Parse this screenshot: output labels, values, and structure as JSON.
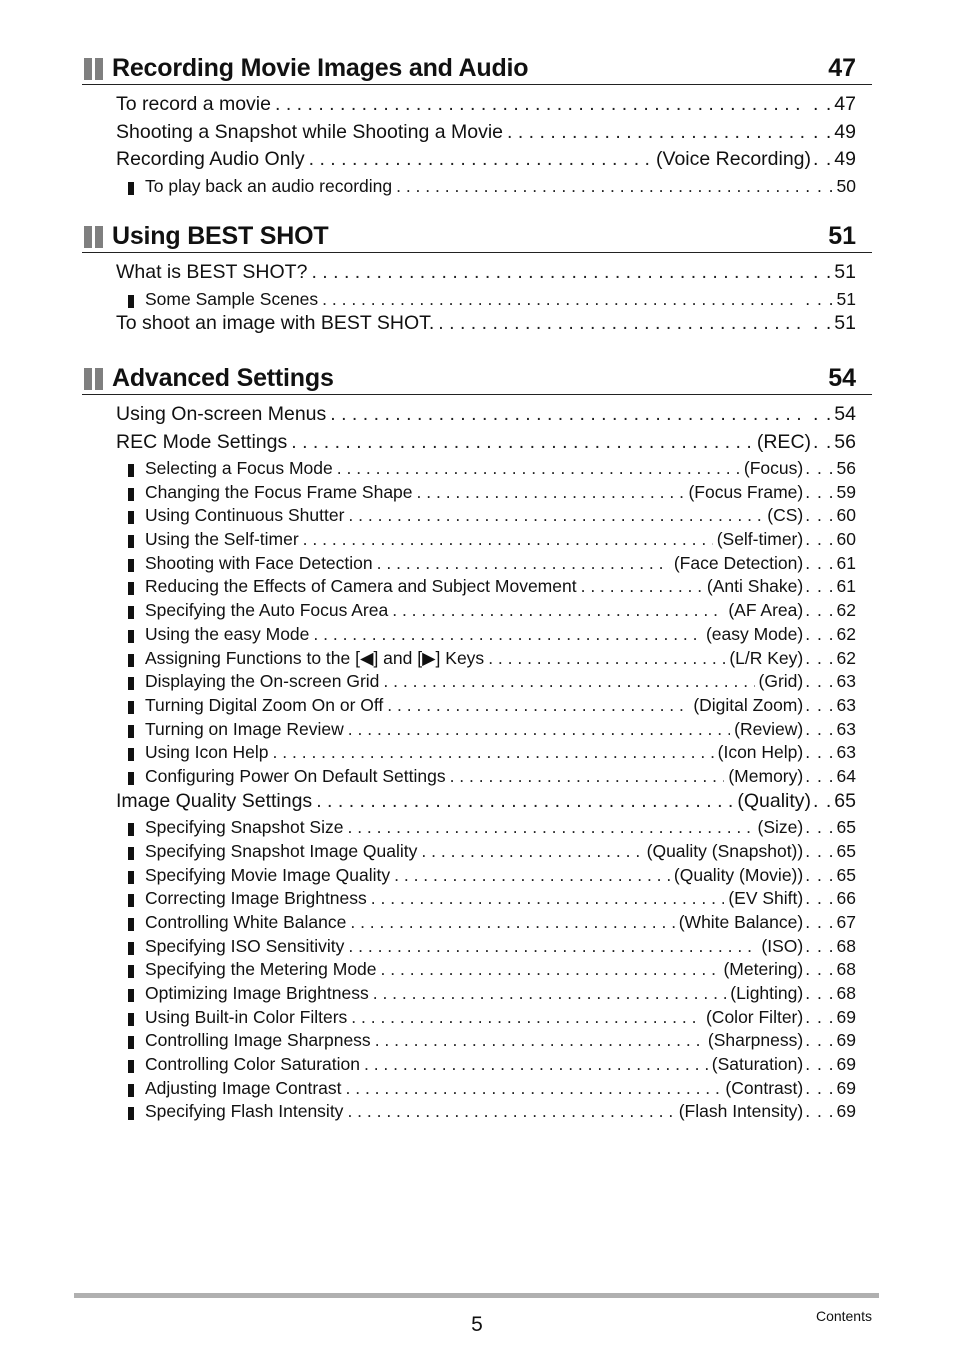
{
  "sections": [
    {
      "title": "Recording Movie Images and Audio",
      "page": "47",
      "entries": [
        {
          "level": "main",
          "label": "To record a movie",
          "tag": "",
          "page": "47"
        },
        {
          "level": "main",
          "label": "Shooting a Snapshot while Shooting a Movie",
          "tag": "",
          "page": "49"
        },
        {
          "level": "main",
          "label": "Recording Audio Only",
          "tag": "(Voice Recording)",
          "page": "49"
        },
        {
          "level": "sub",
          "label": "To play back an audio recording",
          "tag": "",
          "page": "50"
        }
      ]
    },
    {
      "title": "Using BEST SHOT",
      "page": "51",
      "entries": [
        {
          "level": "main",
          "label": "What is BEST SHOT?",
          "tag": "",
          "page": "51"
        },
        {
          "level": "sub",
          "label": "Some Sample Scenes",
          "tag": "",
          "page": "51"
        },
        {
          "level": "main",
          "label": "To shoot an image with BEST SHOT.",
          "tag": "",
          "page": "51"
        }
      ]
    },
    {
      "title": "Advanced Settings",
      "page": "54",
      "entries": [
        {
          "level": "main",
          "label": "Using On-screen Menus",
          "tag": "",
          "page": "54"
        },
        {
          "level": "main",
          "label": "REC Mode Settings",
          "tag": "(REC)",
          "page": "56"
        },
        {
          "level": "sub",
          "label": "Selecting a Focus Mode",
          "tag": "(Focus)",
          "page": "56"
        },
        {
          "level": "sub",
          "label": "Changing the Focus Frame Shape",
          "tag": "(Focus Frame)",
          "page": "59"
        },
        {
          "level": "sub",
          "label": "Using Continuous Shutter",
          "tag": "(CS)",
          "page": "60"
        },
        {
          "level": "sub",
          "label": "Using the Self-timer",
          "tag": "(Self-timer)",
          "page": "60"
        },
        {
          "level": "sub",
          "label": "Shooting with Face Detection",
          "tag": "(Face Detection)",
          "page": "61"
        },
        {
          "level": "sub",
          "label": "Reducing the Effects of Camera and Subject Movement",
          "tag": "(Anti Shake)",
          "page": "61"
        },
        {
          "level": "sub",
          "label": "Specifying the Auto Focus Area",
          "tag": "(AF Area)",
          "page": "62"
        },
        {
          "level": "sub",
          "label": "Using the easy Mode",
          "tag": "(easy Mode)",
          "page": "62"
        },
        {
          "level": "sub",
          "label": "Assigning Functions to the [◀] and [▶] Keys",
          "tag": "(L/R Key)",
          "page": "62"
        },
        {
          "level": "sub",
          "label": "Displaying the On-screen Grid",
          "tag": "(Grid)",
          "page": "63"
        },
        {
          "level": "sub",
          "label": "Turning Digital Zoom On or Off",
          "tag": "(Digital Zoom)",
          "page": "63"
        },
        {
          "level": "sub",
          "label": "Turning on Image Review",
          "tag": "(Review)",
          "page": "63"
        },
        {
          "level": "sub",
          "label": "Using Icon Help",
          "tag": "(Icon Help)",
          "page": "63"
        },
        {
          "level": "sub",
          "label": "Configuring Power On Default Settings",
          "tag": "(Memory)",
          "page": "64"
        },
        {
          "level": "main",
          "label": "Image Quality Settings",
          "tag": "(Quality)",
          "page": "65"
        },
        {
          "level": "sub",
          "label": "Specifying Snapshot Size",
          "tag": "(Size)",
          "page": "65"
        },
        {
          "level": "sub",
          "label": "Specifying Snapshot Image Quality",
          "tag": "(Quality (Snapshot))",
          "page": "65"
        },
        {
          "level": "sub",
          "label": "Specifying Movie Image Quality",
          "tag": "(Quality (Movie))",
          "page": "65"
        },
        {
          "level": "sub",
          "label": "Correcting Image Brightness",
          "tag": "(EV Shift)",
          "page": "66"
        },
        {
          "level": "sub",
          "label": "Controlling White Balance",
          "tag": "(White Balance)",
          "page": "67"
        },
        {
          "level": "sub",
          "label": "Specifying ISO Sensitivity",
          "tag": "(ISO)",
          "page": "68"
        },
        {
          "level": "sub",
          "label": "Specifying the Metering Mode",
          "tag": "(Metering)",
          "page": "68"
        },
        {
          "level": "sub",
          "label": "Optimizing Image Brightness",
          "tag": "(Lighting)",
          "page": "68"
        },
        {
          "level": "sub",
          "label": "Using Built-in Color Filters",
          "tag": "(Color Filter)",
          "page": "69"
        },
        {
          "level": "sub",
          "label": "Controlling Image Sharpness",
          "tag": "(Sharpness)",
          "page": "69"
        },
        {
          "level": "sub",
          "label": "Controlling Color Saturation",
          "tag": "(Saturation)",
          "page": "69"
        },
        {
          "level": "sub",
          "label": "Adjusting Image Contrast",
          "tag": "(Contrast)",
          "page": "69"
        },
        {
          "level": "sub",
          "label": "Specifying Flash Intensity",
          "tag": "(Flash Intensity)",
          "page": "69"
        }
      ]
    }
  ],
  "footer": {
    "page_number": "5",
    "label": "Contents"
  },
  "colors": {
    "heading_bar": "#7f7f7f",
    "footer_rule": "#b0b0b0",
    "text": "#111111"
  }
}
